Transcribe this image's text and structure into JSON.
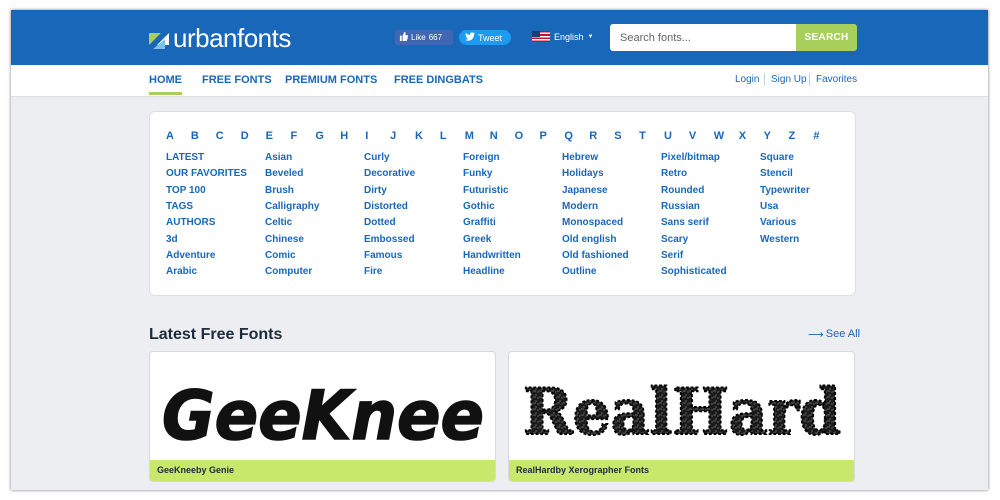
{
  "brand": {
    "name": "urbanfonts"
  },
  "social": {
    "like_label": "Like",
    "like_count": "667",
    "tweet_label": "Tweet"
  },
  "language": {
    "selected": "English"
  },
  "search": {
    "placeholder": "Search fonts...",
    "button_label": "SEARCH"
  },
  "nav": {
    "items": [
      {
        "label": "HOME",
        "active": true
      },
      {
        "label": "FREE FONTS"
      },
      {
        "label": "PREMIUM FONTS"
      },
      {
        "label": "FREE DINGBATS"
      }
    ],
    "right": [
      {
        "label": "Login"
      },
      {
        "label": "Sign Up"
      },
      {
        "label": "Favorites"
      }
    ]
  },
  "alphabet": [
    "A",
    "B",
    "C",
    "D",
    "E",
    "F",
    "G",
    "H",
    "I",
    "J",
    "K",
    "L",
    "M",
    "N",
    "O",
    "P",
    "Q",
    "R",
    "S",
    "T",
    "U",
    "V",
    "W",
    "X",
    "Y",
    "Z",
    "#"
  ],
  "categories": {
    "col1": [
      "LATEST",
      "OUR FAVORITES",
      "TOP 100",
      "TAGS",
      "AUTHORS",
      "3d",
      "Adventure",
      "Arabic"
    ],
    "col2": [
      "Asian",
      "Beveled",
      "Brush",
      "Calligraphy",
      "Celtic",
      "Chinese",
      "Comic",
      "Computer"
    ],
    "col3": [
      "Curly",
      "Decorative",
      "Dirty",
      "Distorted",
      "Dotted",
      "Embossed",
      "Famous",
      "Fire"
    ],
    "col4": [
      "Foreign",
      "Funky",
      "Futuristic",
      "Gothic",
      "Graffiti",
      "Greek",
      "Handwritten",
      "Headline"
    ],
    "col5": [
      "Hebrew",
      "Holidays",
      "Japanese",
      "Modern",
      "Monospaced",
      "Old english",
      "Old fashioned",
      "Outline"
    ],
    "col6": [
      "Pixel/bitmap",
      "Retro",
      "Rounded",
      "Russian",
      "Sans serif",
      "Scary",
      "Serif",
      "Sophisticated"
    ],
    "col7": [
      "Square",
      "Stencil",
      "Typewriter",
      "Usa",
      "Various",
      "Western"
    ]
  },
  "latest": {
    "title": "Latest Free Fonts",
    "see_all": "See All",
    "fonts": [
      {
        "preview_text": "GeeKnee",
        "caption": "GeeKneeby Genie"
      },
      {
        "preview_text": "RealHard",
        "caption": "RealHardby Xerographer Fonts"
      }
    ]
  },
  "colors": {
    "header": "#1967b8",
    "accent": "#a6d05b",
    "link": "#1967b8",
    "caption_bg": "#c7e86b"
  },
  "icons": [
    "logo-mark-icon",
    "facebook-thumb-icon",
    "twitter-bird-icon",
    "us-flag-icon",
    "chevron-down-icon",
    "arrow-right-icon"
  ]
}
